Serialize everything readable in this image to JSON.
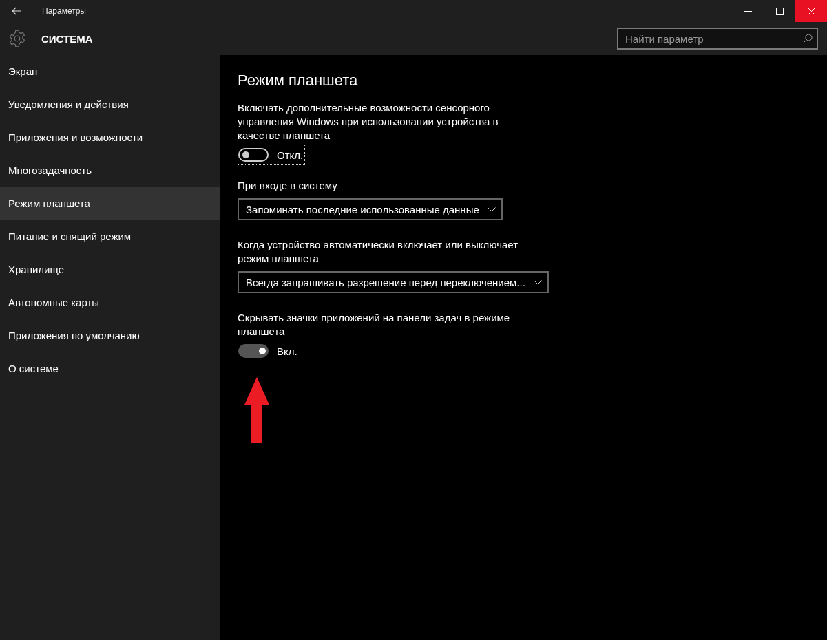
{
  "window": {
    "title": "Параметры"
  },
  "header": {
    "title": "СИСТЕМА"
  },
  "search": {
    "placeholder": "Найти параметр"
  },
  "sidebar": {
    "items": [
      {
        "label": "Экран",
        "selected": false
      },
      {
        "label": "Уведомления и действия",
        "selected": false
      },
      {
        "label": "Приложения и возможности",
        "selected": false
      },
      {
        "label": "Многозадачность",
        "selected": false
      },
      {
        "label": "Режим планшета",
        "selected": true
      },
      {
        "label": "Питание и спящий режим",
        "selected": false
      },
      {
        "label": "Хранилище",
        "selected": false
      },
      {
        "label": "Автономные карты",
        "selected": false
      },
      {
        "label": "Приложения по умолчанию",
        "selected": false
      },
      {
        "label": "О системе",
        "selected": false
      }
    ]
  },
  "page": {
    "title": "Режим планшета",
    "settings": [
      {
        "kind": "toggle",
        "label": "Включать дополнительные возможности сенсорного управления Windows при использовании устройства в качестве планшета",
        "on": false,
        "focused": true,
        "state_text": "Откл."
      },
      {
        "kind": "dropdown",
        "label": "При входе в систему",
        "value": "Запоминать последние использованные данные"
      },
      {
        "kind": "dropdown",
        "label": "Когда устройство автоматически включает или выключает режим планшета",
        "value": "Всегда запрашивать разрешение перед переключением..."
      },
      {
        "kind": "toggle",
        "label": "Скрывать значки приложений на панели задач в режиме планшета",
        "on": true,
        "focused": false,
        "state_text": "Вкл."
      }
    ]
  }
}
